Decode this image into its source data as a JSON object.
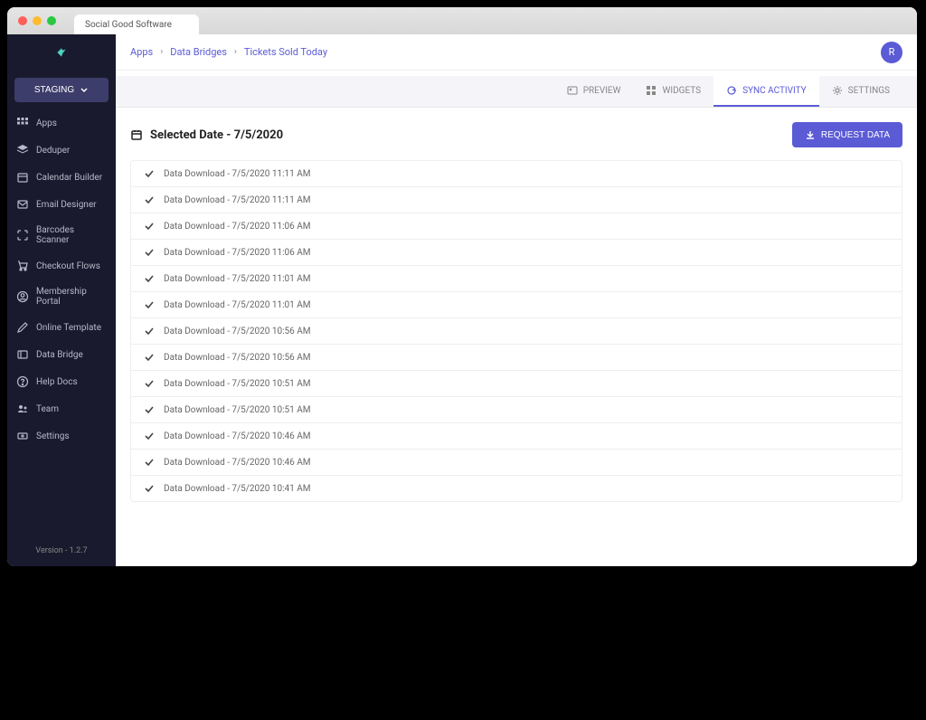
{
  "browser": {
    "tab_title": "Social Good Software"
  },
  "sidebar": {
    "env_label": "STAGING",
    "items": [
      {
        "label": "Apps"
      },
      {
        "label": "Deduper"
      },
      {
        "label": "Calendar Builder"
      },
      {
        "label": "Email Designer"
      },
      {
        "label": "Barcodes Scanner"
      },
      {
        "label": "Checkout Flows"
      },
      {
        "label": "Membership Portal"
      },
      {
        "label": "Online Template"
      },
      {
        "label": "Data Bridge"
      },
      {
        "label": "Help Docs"
      },
      {
        "label": "Team"
      },
      {
        "label": "Settings"
      }
    ],
    "version": "Version - 1.2.7"
  },
  "breadcrumb": {
    "items": [
      "Apps",
      "Data Bridges",
      "Tickets Sold Today"
    ]
  },
  "avatar": "R",
  "tabs": {
    "preview": "PREVIEW",
    "widgets": "WIDGETS",
    "sync_activity": "SYNC ACTIVITY",
    "settings": "SETTINGS"
  },
  "selected_date_label": "Selected Date - 7/5/2020",
  "request_data_label": "REQUEST DATA",
  "rows": [
    "Data Download - 7/5/2020 11:11 AM",
    "Data Download - 7/5/2020 11:11 AM",
    "Data Download - 7/5/2020 11:06 AM",
    "Data Download - 7/5/2020 11:06 AM",
    "Data Download - 7/5/2020 11:01 AM",
    "Data Download - 7/5/2020 11:01 AM",
    "Data Download - 7/5/2020 10:56 AM",
    "Data Download - 7/5/2020 10:56 AM",
    "Data Download - 7/5/2020 10:51 AM",
    "Data Download - 7/5/2020 10:51 AM",
    "Data Download - 7/5/2020 10:46 AM",
    "Data Download - 7/5/2020 10:46 AM",
    "Data Download - 7/5/2020 10:41 AM"
  ]
}
